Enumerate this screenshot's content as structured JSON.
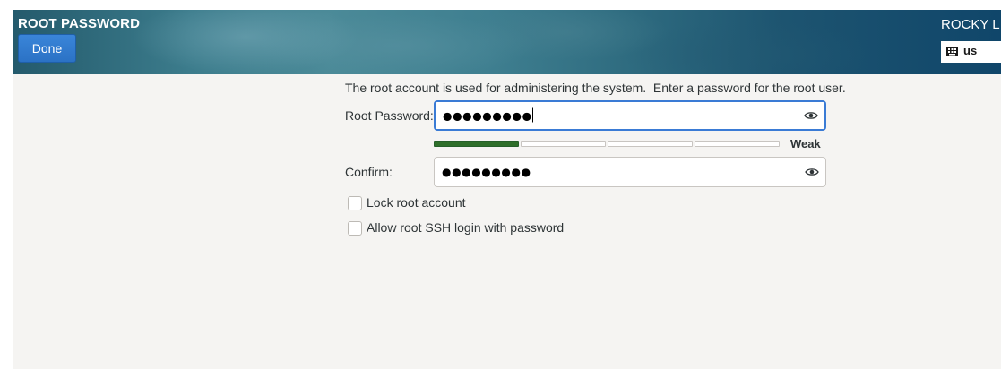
{
  "header": {
    "title": "ROOT PASSWORD",
    "done_label": "Done",
    "product_name": "ROCKY LI",
    "keyboard_layout": "us",
    "colors": {
      "accent_button": "#2b72c5",
      "header_dark": "#10466a"
    }
  },
  "form": {
    "intro_text": "The root account is used for administering the system.  Enter a password for the root user.",
    "root_password": {
      "label": "Root Password:",
      "value_masked": "●●●●●●●●●",
      "reveal_icon": "eye-icon"
    },
    "strength": {
      "level_fraction": 0.25,
      "label": "Weak",
      "color": "#2f6f2a"
    },
    "confirm": {
      "label": "Confirm:",
      "value_masked": "●●●●●●●●●",
      "reveal_icon": "eye-icon"
    },
    "lock_root": {
      "label": "Lock root account",
      "checked": false
    },
    "allow_ssh": {
      "label": "Allow root SSH login with password",
      "checked": false
    }
  }
}
